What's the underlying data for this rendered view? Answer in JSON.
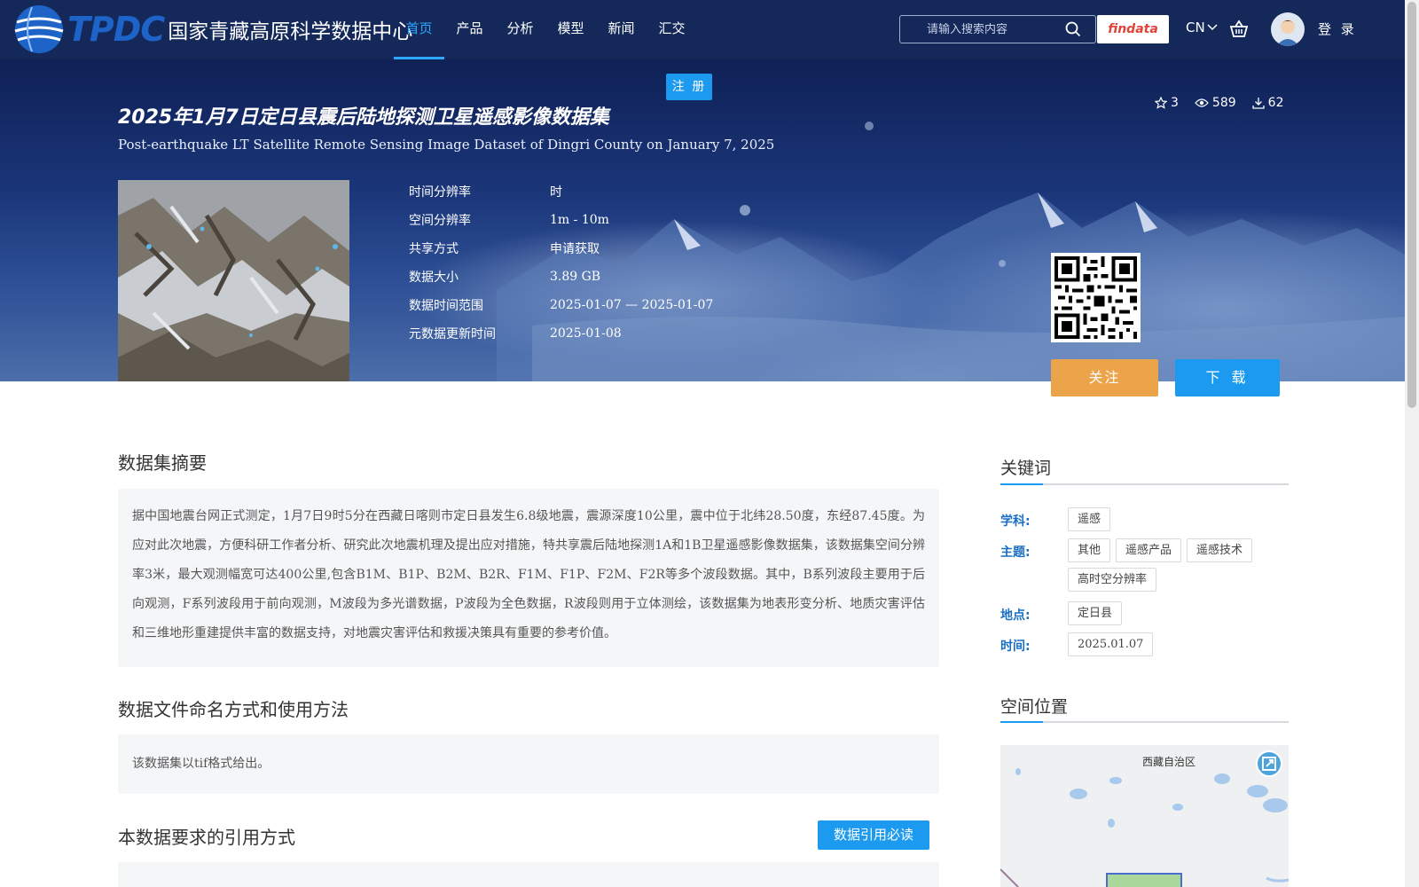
{
  "nav": {
    "logo_mark": "TPDC",
    "logo_name": "国家青藏高原科学数据中心",
    "menu": [
      {
        "label": "首页",
        "active": true
      },
      {
        "label": "产品",
        "active": false
      },
      {
        "label": "分析",
        "active": false
      },
      {
        "label": "模型",
        "active": false
      },
      {
        "label": "新闻",
        "active": false
      },
      {
        "label": "汇交",
        "active": false
      }
    ],
    "search_placeholder": "请输入搜索内容",
    "findata_label": "findata",
    "lang": "CN",
    "login": "登 录",
    "register": "注 册"
  },
  "dataset": {
    "title_cn": "2025年1月7日定日县震后陆地探测卫星遥感影像数据集",
    "title_en": "Post-earthquake LT Satellite Remote Sensing Image Dataset of Dingri County on January 7, 2025",
    "stars": "3",
    "views": "589",
    "downloads": "62",
    "meta": [
      {
        "label": "时间分辨率",
        "value": "时"
      },
      {
        "label": "空间分辨率",
        "value": "1m - 10m"
      },
      {
        "label": "共享方式",
        "value": "申请获取"
      },
      {
        "label": "数据大小",
        "value": "3.89 GB"
      },
      {
        "label": "数据时间范围",
        "value": "2025-01-07 — 2025-01-07"
      },
      {
        "label": "元数据更新时间",
        "value": "2025-01-08"
      }
    ],
    "follow_label": "关注",
    "download_label": "下 载"
  },
  "main": {
    "abstract_title": "数据集摘要",
    "abstract_text": "据中国地震台网正式测定，1月7日9时5分在西藏日喀则市定日县发生6.8级地震，震源深度10公里，震中位于北纬28.50度，东经87.45度。为应对此次地震，方便科研工作者分析、研究此次地震机理及提出应对措施，特共享震后陆地探测1A和1B卫星遥感影像数据集，该数据集空间分辨率3米，最大观测幅宽可达400公里,包含B1M、B1P、B2M、B2R、F1M、F1P、F2M、F2R等多个波段数据。其中，B系列波段主要用于后向观测，F系列波段用于前向观测，M波段为多光谱数据，P波段为全色数据，R波段则用于立体测绘，该数据集为地表形变分析、地质灾害评估和三维地形重建提供丰富的数据支持，对地震灾害评估和救援决策具有重要的参考价值。",
    "naming_title": "数据文件命名方式和使用方法",
    "naming_text": "该数据集以tif格式给出。",
    "citation_title": "本数据要求的引用方式",
    "citation_button": "数据引用必读"
  },
  "side": {
    "keywords_title": "关键词",
    "keywords": [
      {
        "label": "学科:",
        "tags": [
          "遥感"
        ]
      },
      {
        "label": "主题:",
        "tags": [
          "其他",
          "遥感产品",
          "遥感技术",
          "高时空分辨率"
        ]
      },
      {
        "label": "地点:",
        "tags": [
          "定日县"
        ]
      },
      {
        "label": "时间:",
        "tags": [
          "2025.01.07"
        ]
      }
    ],
    "location_title": "空间位置",
    "map_label": "西藏自治区"
  },
  "colors": {
    "accent": "#1b9af0",
    "follow": "#eca44a",
    "nav": "#14285a",
    "keyword_label": "#1b6fc4"
  }
}
